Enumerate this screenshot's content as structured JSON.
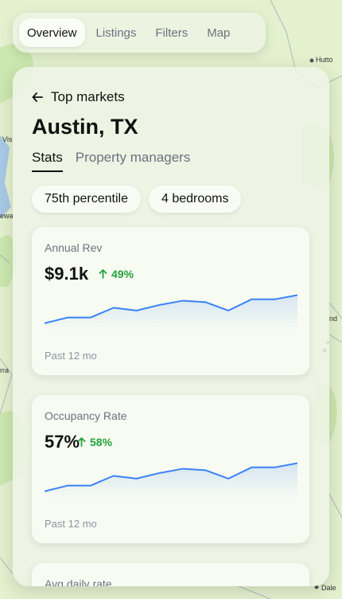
{
  "map": {
    "labels": [
      "Hutto",
      "Vis",
      "ewa",
      "rra",
      "Dale",
      "nd"
    ]
  },
  "tabs": [
    {
      "label": "Overview",
      "active": true
    },
    {
      "label": "Listings",
      "active": false
    },
    {
      "label": "Filters",
      "active": false
    },
    {
      "label": "Map",
      "active": false
    }
  ],
  "panel": {
    "back_label": "Top markets",
    "city": "Austin, TX",
    "subtabs": [
      {
        "label": "Stats",
        "active": true
      },
      {
        "label": "Property managers",
        "active": false
      }
    ],
    "filters": [
      "75th percentile",
      "4 bedrooms"
    ]
  },
  "colors": {
    "accent_line": "#3b82f6",
    "positive": "#22a33a"
  },
  "cards": [
    {
      "label": "Annual Rev",
      "value": "$9.1k",
      "change": "49%",
      "period": "Past 12 mo",
      "chart_data": {
        "type": "area",
        "values": [
          3,
          7,
          7,
          14,
          12,
          16,
          19,
          18,
          12,
          20,
          20,
          23
        ]
      }
    },
    {
      "label": "Occupancy Rate",
      "value": "57%",
      "change": "58%",
      "period": "Past 12 mo",
      "chart_data": {
        "type": "area",
        "values": [
          3,
          7,
          7,
          14,
          12,
          16,
          19,
          18,
          12,
          20,
          20,
          23
        ]
      }
    },
    {
      "label": "Avg daily rate"
    }
  ]
}
